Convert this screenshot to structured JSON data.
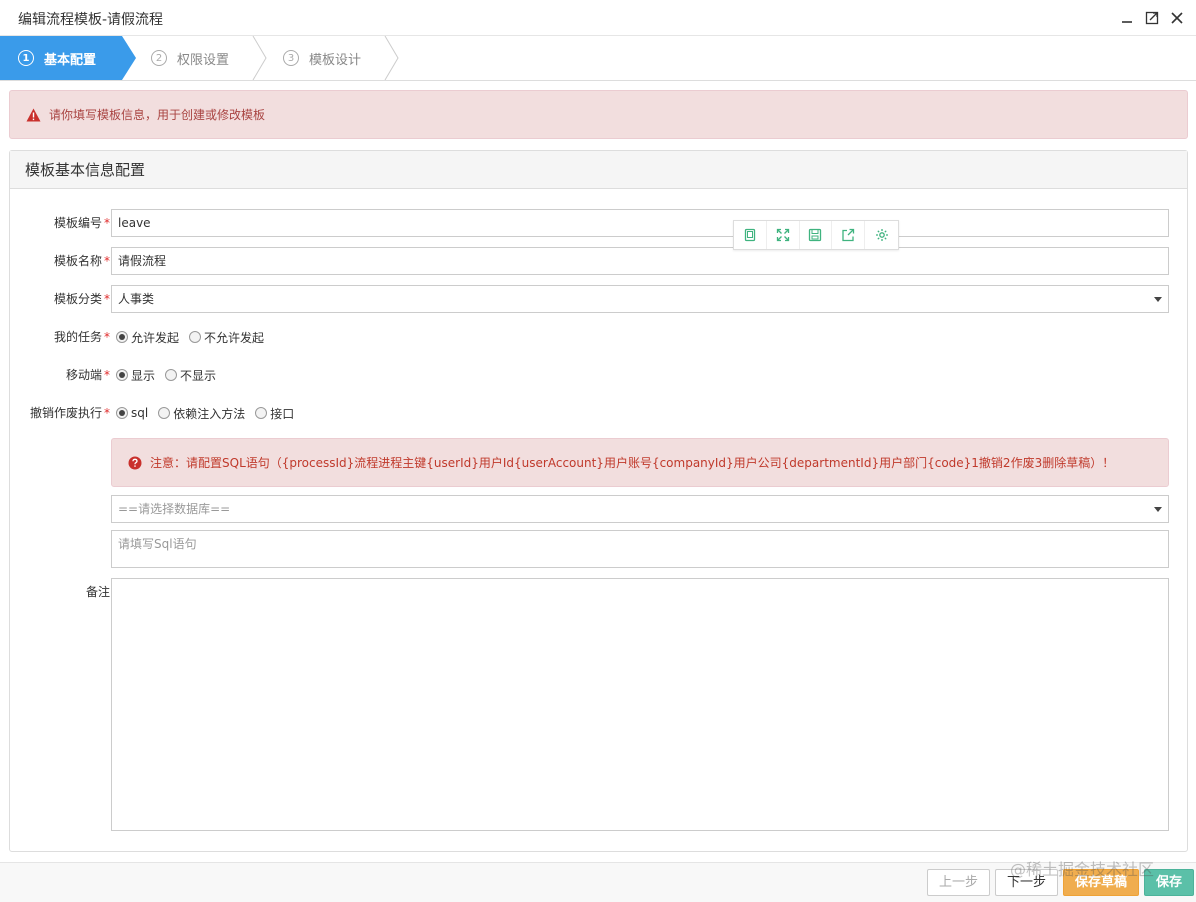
{
  "window": {
    "title": "编辑流程模板-请假流程"
  },
  "steps": [
    {
      "num": "1",
      "label": "基本配置"
    },
    {
      "num": "2",
      "label": "权限设置"
    },
    {
      "num": "3",
      "label": "模板设计"
    }
  ],
  "top_alert": "请你填写模板信息，用于创建或修改模板",
  "panel": {
    "title": "模板基本信息配置"
  },
  "form": {
    "code": {
      "label": "模板编号",
      "value": "leave"
    },
    "name": {
      "label": "模板名称",
      "value": "请假流程"
    },
    "category": {
      "label": "模板分类",
      "value": "人事类"
    },
    "my_task": {
      "label": "我的任务",
      "options": [
        "允许发起",
        "不允许发起"
      ],
      "selected": "允许发起"
    },
    "mobile": {
      "label": "移动端",
      "options": [
        "显示",
        "不显示"
      ],
      "selected": "显示"
    },
    "revoke": {
      "label": "撤销作废执行",
      "options": [
        "sql",
        "依赖注入方法",
        "接口"
      ],
      "selected": "sql"
    },
    "sql_notice": "注意：请配置SQL语句（{processId}流程进程主键{userId}用户Id{userAccount}用户账号{companyId}用户公司{departmentId}用户部门{code}1撤销2作废3删除草稿）！",
    "database": {
      "placeholder": "==请选择数据库=="
    },
    "sql": {
      "placeholder": "请填写Sql语句"
    },
    "remark": {
      "label": "备注",
      "value": ""
    }
  },
  "footer": {
    "prev": "上一步",
    "next": "下一步",
    "draft": "保存草稿",
    "save": "保存"
  },
  "watermark": "@稀土掘金技术社区",
  "colors": {
    "accent": "#3a9bea",
    "toolbar_icon": "#3fb37f",
    "alert_bg": "#f2dede",
    "draft_btn": "#f0ad4e",
    "save_btn": "#5bc0a8"
  }
}
